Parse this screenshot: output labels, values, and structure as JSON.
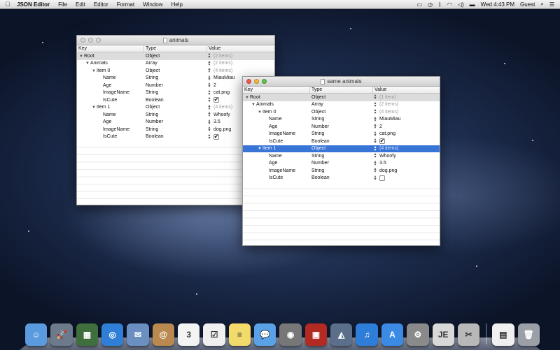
{
  "menubar": {
    "app_name": "JSON Editor",
    "items": [
      "File",
      "Edit",
      "Editor",
      "Format",
      "Window",
      "Help"
    ],
    "clock": "Wed 4:43 PM",
    "user": "Guest"
  },
  "columns": {
    "key": "Key",
    "type": "Type",
    "value": "Value"
  },
  "window1": {
    "title": "animals",
    "rows": [
      {
        "key": "Root",
        "type": "Object",
        "value": "(2 items)",
        "dim": true,
        "expand": true
      },
      {
        "key": "Animals",
        "type": "Array",
        "value": "(2 items)",
        "dim": true,
        "expand": true
      },
      {
        "key": "Item 0",
        "type": "Object",
        "value": "(4 items)",
        "dim": true,
        "expand": true
      },
      {
        "key": "Name",
        "type": "String",
        "value": "MiauMiau"
      },
      {
        "key": "Age",
        "type": "Number",
        "value": "2"
      },
      {
        "key": "ImageName",
        "type": "String",
        "value": "cat.png"
      },
      {
        "key": "IsCute",
        "type": "Boolean",
        "value": "",
        "checkbox": true,
        "checked": true
      },
      {
        "key": "Item 1",
        "type": "Object",
        "value": "(4 items)",
        "dim": true,
        "expand": true
      },
      {
        "key": "Name",
        "type": "String",
        "value": "Whoofy"
      },
      {
        "key": "Age",
        "type": "Number",
        "value": "3.5"
      },
      {
        "key": "ImageName",
        "type": "String",
        "value": "dog.png"
      },
      {
        "key": "IsCute",
        "type": "Boolean",
        "value": "",
        "checkbox": true,
        "checked": true
      }
    ]
  },
  "window2": {
    "title": "same animals",
    "rows": [
      {
        "key": "Root",
        "type": "Object",
        "value": "(1 item)",
        "dim": true,
        "expand": true
      },
      {
        "key": "Animals",
        "type": "Array",
        "value": "(2 items)",
        "dim": true,
        "expand": true
      },
      {
        "key": "Item 0",
        "type": "Object",
        "value": "(4 items)",
        "dim": true,
        "expand": true
      },
      {
        "key": "Name",
        "type": "String",
        "value": "MiauMiau"
      },
      {
        "key": "Age",
        "type": "Number",
        "value": "2"
      },
      {
        "key": "ImageName",
        "type": "String",
        "value": "cat.png"
      },
      {
        "key": "IsCute",
        "type": "Boolean",
        "value": "",
        "checkbox": true,
        "checked": true
      },
      {
        "key": "Item 1",
        "type": "Object",
        "value": "(4 items)",
        "dim": true,
        "expand": true,
        "selected": true
      },
      {
        "key": "Name",
        "type": "String",
        "value": "Whoofy"
      },
      {
        "key": "Age",
        "type": "Number",
        "value": "3.5"
      },
      {
        "key": "ImageName",
        "type": "String",
        "value": "dog.png"
      },
      {
        "key": "IsCute",
        "type": "Boolean",
        "value": "",
        "checkbox": true,
        "checked": false
      }
    ]
  },
  "dock": {
    "icons": [
      {
        "name": "finder-icon",
        "color": "#5a9be0",
        "glyph": "☺"
      },
      {
        "name": "launchpad-icon",
        "color": "#6d7a8c",
        "glyph": "🚀"
      },
      {
        "name": "mission-control-icon",
        "color": "#3e6f3c",
        "glyph": "▦"
      },
      {
        "name": "safari-icon",
        "color": "#2f7fd6",
        "glyph": "◎"
      },
      {
        "name": "mail-icon",
        "color": "#6b8fc1",
        "glyph": "✉"
      },
      {
        "name": "contacts-icon",
        "color": "#b9894f",
        "glyph": "@"
      },
      {
        "name": "calendar-icon",
        "color": "#f4f4f4",
        "glyph": "3"
      },
      {
        "name": "reminders-icon",
        "color": "#f0f0f0",
        "glyph": "☑"
      },
      {
        "name": "notes-icon",
        "color": "#f2da6b",
        "glyph": "≡"
      },
      {
        "name": "messages-icon",
        "color": "#5aa2e8",
        "glyph": "💬"
      },
      {
        "name": "facetime-icon",
        "color": "#777777",
        "glyph": "◉"
      },
      {
        "name": "photo-booth-icon",
        "color": "#b22a22",
        "glyph": "▣"
      },
      {
        "name": "iphoto-icon",
        "color": "#5b6e8a",
        "glyph": "◭"
      },
      {
        "name": "itunes-icon",
        "color": "#2e7dd8",
        "glyph": "♫"
      },
      {
        "name": "app-store-icon",
        "color": "#3b8be5",
        "glyph": "A"
      },
      {
        "name": "system-preferences-icon",
        "color": "#8a8a8a",
        "glyph": "⚙"
      },
      {
        "name": "json-editor-icon",
        "color": "#d8d8d8",
        "glyph": "JE"
      },
      {
        "name": "scissors-icon",
        "color": "#b8b8b8",
        "glyph": "✂"
      },
      {
        "name": "document-icon",
        "color": "#f0f0f0",
        "glyph": "▤"
      },
      {
        "name": "trash-icon",
        "color": "#9a9fa8",
        "glyph": "🗑"
      }
    ]
  }
}
